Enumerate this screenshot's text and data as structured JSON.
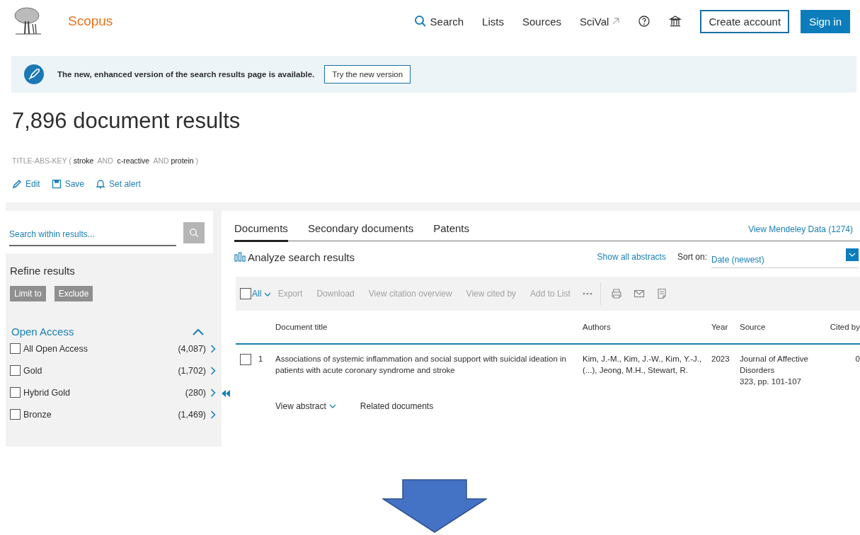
{
  "header": {
    "logo": "Scopus",
    "nav": [
      {
        "label": "Search",
        "kind": "search"
      },
      {
        "label": "Lists",
        "kind": "plain"
      },
      {
        "label": "Sources",
        "kind": "plain"
      },
      {
        "label": "SciVal",
        "kind": "external"
      }
    ],
    "create_account": "Create account",
    "sign_in": "Sign in"
  },
  "banner": {
    "message": "The new, enhanced version of the search results page is available.",
    "button": "Try the new version"
  },
  "results_title": "7,896 document results",
  "query": "TITLE-ABS-KEY ( **stroke**  AND  **c-reactive**  AND **protein** )",
  "query_actions": [
    {
      "label": "Edit",
      "kind": "edit"
    },
    {
      "label": "Save",
      "kind": "save"
    },
    {
      "label": "Set alert",
      "kind": "alert"
    }
  ],
  "sidebar": {
    "search_placeholder": "Search within results...",
    "refine_title": "Refine results",
    "buttons": [
      "Limit to",
      "Exclude"
    ],
    "facet": {
      "title": "Open Access",
      "expanded": true,
      "options": [
        {
          "label": "All Open Access",
          "count": "(4,087)",
          "checked": false
        },
        {
          "label": "Gold",
          "count": "(1,702)",
          "checked": false
        },
        {
          "label": "Hybrid Gold",
          "count": "(280)",
          "checked": false
        },
        {
          "label": "Bronze",
          "count": "(1,469)",
          "checked": false
        }
      ]
    }
  },
  "tabs": [
    {
      "label": "Documents",
      "selected": true
    },
    {
      "label": "Secondary documents",
      "selected": false
    },
    {
      "label": "Patents",
      "selected": false
    }
  ],
  "mendeley_link": "View Mendeley Data (1274)",
  "analyze": "Analyze search results",
  "show_all_abstracts": "Show all abstracts",
  "sort": {
    "label": "Sort on:",
    "value": "Date (newest)"
  },
  "toolbar": {
    "select_all": {
      "label": "All",
      "checked": false
    },
    "actions": [
      {
        "label": "Export",
        "disabled": true
      },
      {
        "label": "Download",
        "disabled": true
      },
      {
        "label": "View citation overview",
        "disabled": true
      },
      {
        "label": "View cited by",
        "disabled": true
      },
      {
        "label": "Add to List",
        "disabled": true
      }
    ]
  },
  "table": {
    "columns": [
      "Document title",
      "Authors",
      "Year",
      "Source",
      "Cited by"
    ],
    "rows": [
      {
        "number": "1",
        "checked": false,
        "title": "Associations of systemic inflammation and social support with suicidal ideation in patients with acute coronary syndrome and stroke",
        "authors": "Kim, J.-M., Kim, J.-W., Kim, Y.-J., (...), Jeong, M.H., Stewart, R.",
        "year": "2023",
        "source_title": "Journal of Affective Disorders",
        "source_detail": "323, pp. 101-107",
        "cited_by": "0",
        "actions": [
          {
            "label": "View abstract",
            "kind": "expand"
          },
          {
            "label": "Related documents",
            "kind": "link"
          }
        ]
      }
    ]
  }
}
